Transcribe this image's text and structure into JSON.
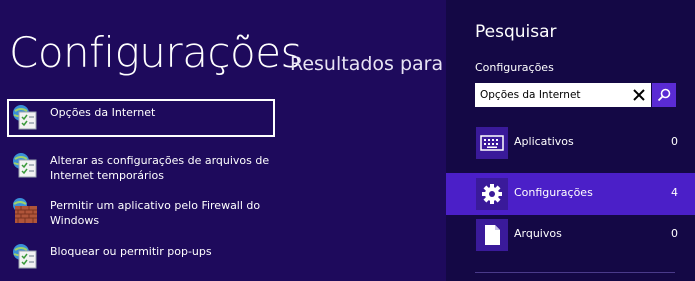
{
  "left": {
    "title": "Configurações",
    "results_heading": "Resultados para \"O",
    "results": [
      {
        "label": "Opções da Internet",
        "icon": "internet-options-icon",
        "selected": true
      },
      {
        "label": "Alterar as configurações de arquivos de Internet temporários",
        "icon": "internet-options-icon",
        "selected": false
      },
      {
        "label": "Permitir um aplicativo pelo Firewall do Windows",
        "icon": "firewall-icon",
        "selected": false
      },
      {
        "label": "Bloquear ou permitir pop-ups",
        "icon": "internet-options-icon",
        "selected": false
      }
    ]
  },
  "charm": {
    "title": "Pesquisar",
    "scope": "Configurações",
    "search": {
      "value": "Opções da Internet",
      "placeholder": ""
    },
    "categories": [
      {
        "name": "Aplicativos",
        "count": "0",
        "icon": "keyboard-icon",
        "active": false
      },
      {
        "name": "Configurações",
        "count": "4",
        "icon": "gear-icon",
        "active": true
      },
      {
        "name": "Arquivos",
        "count": "0",
        "icon": "document-icon",
        "active": false
      }
    ]
  },
  "colors": {
    "background": "#1e0a5c",
    "charm_background": "#140845",
    "accent": "#4b1fc8",
    "search_button": "#5a2bd4"
  }
}
